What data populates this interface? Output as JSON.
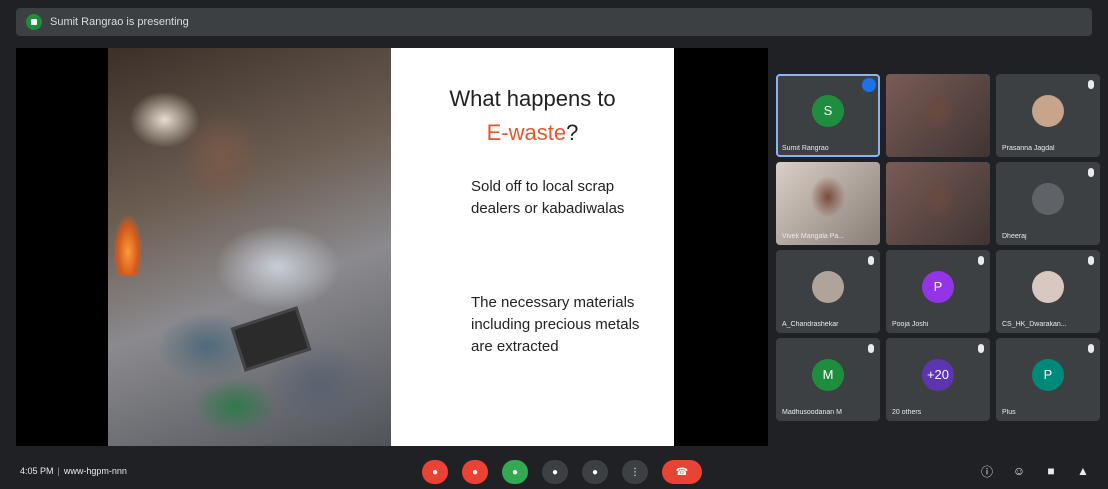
{
  "banner": {
    "text": "Sumit Rangrao is presenting"
  },
  "slide": {
    "title_line1": "What happens to",
    "title_line2": "E-waste",
    "title_mark": "?",
    "point1": "Sold off to local scrap dealers or kabadiwalas",
    "point2": "The necessary materials including precious metals are extracted"
  },
  "participants": [
    {
      "name": "Sumit Rangrao",
      "initial": "S",
      "avatar_color": "#1e8e3e",
      "kind": "avatar",
      "speaking": true
    },
    {
      "name": "",
      "initial": "",
      "avatar_color": "",
      "kind": "video",
      "speaking": false
    },
    {
      "name": "Prasanna Jagdal",
      "initial": "",
      "avatar_color": "#c7a48a",
      "kind": "photo",
      "speaking": false
    },
    {
      "name": "Vivek Mangala Pa...",
      "initial": "",
      "avatar_color": "",
      "kind": "video",
      "speaking": false
    },
    {
      "name": "",
      "initial": "",
      "avatar_color": "",
      "kind": "video",
      "speaking": false
    },
    {
      "name": "Dheeraj",
      "initial": "",
      "avatar_color": "#5f6368",
      "kind": "photo",
      "speaking": false
    },
    {
      "name": "A_Chandrashekar",
      "initial": "",
      "avatar_color": "#b0a49a",
      "kind": "photo",
      "speaking": false
    },
    {
      "name": "Pooja Joshi",
      "initial": "P",
      "avatar_color": "#9334e6",
      "kind": "avatar",
      "speaking": false
    },
    {
      "name": "CS_HK_Dwarakan...",
      "initial": "",
      "avatar_color": "#d9c8c0",
      "kind": "photo",
      "speaking": false
    },
    {
      "name": "Madhusoodanan M",
      "initial": "M",
      "avatar_color": "#1e8e3e",
      "kind": "avatar",
      "speaking": false
    },
    {
      "name": "20 others",
      "initial": "+20",
      "avatar_color": "#5e35b1",
      "kind": "avatar",
      "speaking": false
    },
    {
      "name": "Plus",
      "initial": "P",
      "avatar_color": "#00897b",
      "kind": "avatar",
      "speaking": false
    }
  ],
  "bottom": {
    "time": "4:05 PM",
    "meeting_code": "www-hgpm-nnn"
  },
  "controls": [
    {
      "name": "mic-off-button",
      "label": "",
      "style": "red"
    },
    {
      "name": "camera-off-button",
      "label": "",
      "style": "red"
    },
    {
      "name": "captions-button",
      "label": "",
      "style": "green"
    },
    {
      "name": "raise-hand-button",
      "label": "",
      "style": "grey"
    },
    {
      "name": "present-button",
      "label": "",
      "style": "grey"
    },
    {
      "name": "more-options-button",
      "label": "",
      "style": "grey"
    },
    {
      "name": "leave-call-button",
      "label": "",
      "style": "red",
      "wide": true
    }
  ],
  "right_controls": [
    "info-icon",
    "people-icon",
    "chat-icon",
    "activities-icon"
  ],
  "colors": {
    "background": "#202124",
    "tile": "#3c4043",
    "accent_red": "#ea4335",
    "slide_highlight": "#e8552f"
  }
}
